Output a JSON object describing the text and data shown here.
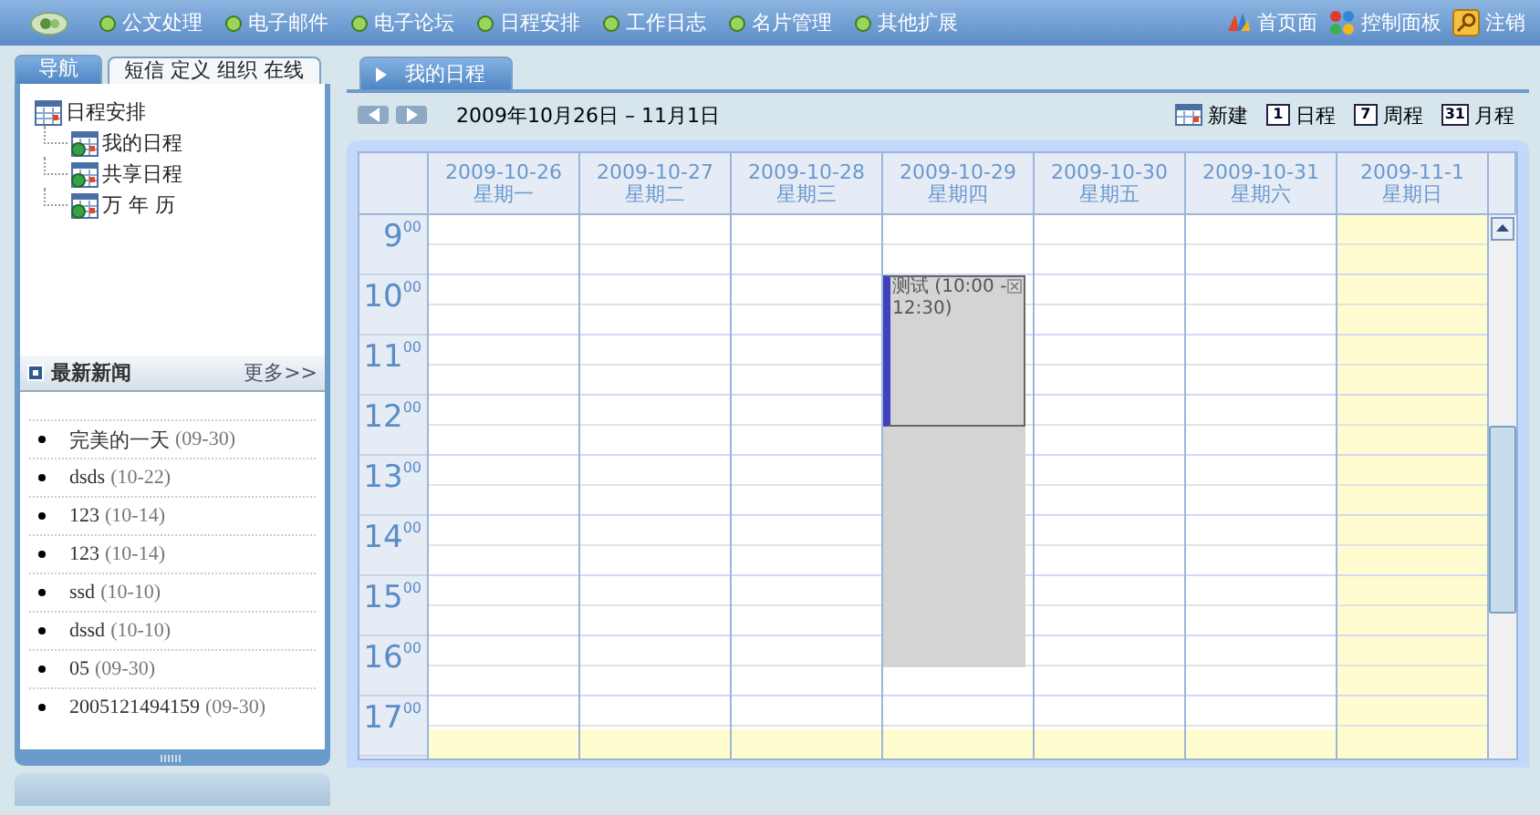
{
  "top_nav": {
    "items": [
      {
        "label": "公文处理"
      },
      {
        "label": "电子邮件"
      },
      {
        "label": "电子论坛"
      },
      {
        "label": "日程安排"
      },
      {
        "label": "工作日志"
      },
      {
        "label": "名片管理"
      },
      {
        "label": "其他扩展"
      }
    ],
    "right_links": [
      {
        "label": "首页面",
        "kind": "home"
      },
      {
        "label": "控制面板",
        "kind": "panel"
      },
      {
        "label": "注销",
        "kind": "logout"
      }
    ]
  },
  "sidebar": {
    "tabs": [
      {
        "label": "导航",
        "selected": true
      },
      {
        "label": "短信 定义 组织 在线",
        "selected": false
      }
    ],
    "tree": [
      {
        "label": "日程安排",
        "children": [
          {
            "label": "我的日程"
          },
          {
            "label": "共享日程"
          },
          {
            "label": "万 年 历"
          }
        ]
      }
    ],
    "news": {
      "title": "最新新闻",
      "more": "更多>>",
      "items": [
        {
          "title": "完美的一天",
          "date": "(09-30)"
        },
        {
          "title": "dsds",
          "date": "(10-22)"
        },
        {
          "title": "123",
          "date": "(10-14)"
        },
        {
          "title": "123",
          "date": "(10-14)"
        },
        {
          "title": "ssd",
          "date": "(10-10)"
        },
        {
          "title": "dssd",
          "date": "(10-10)"
        },
        {
          "title": "05",
          "date": "(09-30)"
        },
        {
          "title": "2005121494159",
          "date": "(09-30)"
        }
      ]
    }
  },
  "main": {
    "tabs": [
      {
        "label": "我的日程",
        "selected": true
      }
    ],
    "range": "2009年10月26日 – 11月1日",
    "actions": [
      {
        "label": "新建",
        "kind": "new"
      },
      {
        "label": "日程",
        "kind": "day",
        "glyph": "1"
      },
      {
        "label": "周程",
        "kind": "week",
        "glyph": "7"
      },
      {
        "label": "月程",
        "kind": "month",
        "glyph": "31"
      }
    ],
    "days": [
      {
        "date": "2009-10-26",
        "weekday": "星期一",
        "highlighted": false
      },
      {
        "date": "2009-10-27",
        "weekday": "星期二",
        "highlighted": false
      },
      {
        "date": "2009-10-28",
        "weekday": "星期三",
        "highlighted": false
      },
      {
        "date": "2009-10-29",
        "weekday": "星期四",
        "highlighted": false,
        "events": [
          {
            "text": "测试 (10:00 - 12:30)",
            "shaded": true
          }
        ]
      },
      {
        "date": "2009-10-30",
        "weekday": "星期五",
        "highlighted": false
      },
      {
        "date": "2009-10-31",
        "weekday": "星期六",
        "highlighted": false
      },
      {
        "date": "2009-11-1",
        "weekday": "星期日",
        "highlighted": true
      }
    ],
    "hours": [
      "9$^{00}$",
      "10$^{00}$",
      "11$^{00}$",
      "12$^{00}$",
      "13$^{00}$",
      "14$^{00}$",
      "15$^{00}$",
      "16$^{00}$",
      "17$^{00}$"
    ]
  }
}
